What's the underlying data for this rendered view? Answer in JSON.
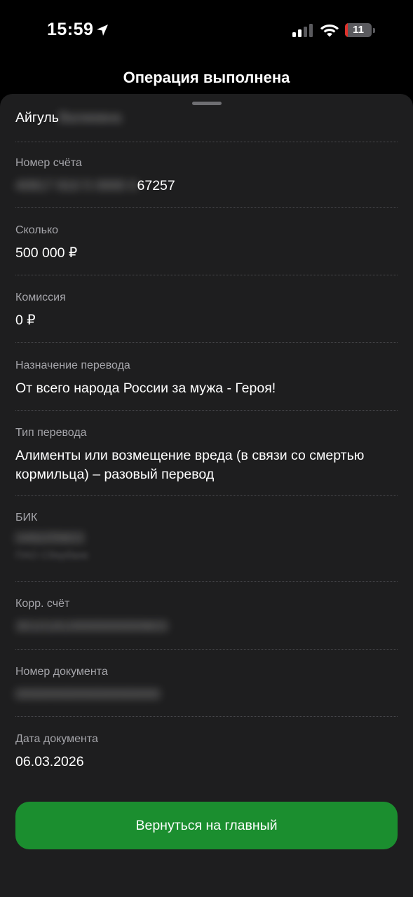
{
  "status_bar": {
    "time": "15:59",
    "battery_level": "11",
    "battery_fraction": 0.11,
    "location_icon": "location-arrow-icon",
    "signal_icon": "cellular-signal-icon",
    "wifi_icon": "wifi-icon",
    "battery_icon": "battery-icon"
  },
  "header": {
    "title": "Операция выполнена"
  },
  "recipient": {
    "name_visible": "Айгуль",
    "name_hidden": "Валиевна"
  },
  "details": {
    "account": {
      "label": "Номер счёта",
      "value_hidden": "40817 810 5 0000 0",
      "value_visible": "67257"
    },
    "amount": {
      "label": "Сколько",
      "value": "500 000 ₽"
    },
    "commission": {
      "label": "Комиссия",
      "value": "0 ₽"
    },
    "purpose": {
      "label": "Назначение перевода",
      "value": "От всего народа России за мужа - Героя!"
    },
    "transfer_type": {
      "label": "Тип перевода",
      "value": "Алименты или возмещение вреда (в связи со смертью кормильца) – разовый перевод"
    },
    "bik": {
      "label": "БИК",
      "value_hidden": "049205603",
      "bank_hidden": "ПАО Сбербанк"
    },
    "corr_account": {
      "label": "Корр. счёт",
      "value_hidden": "30101810000000000603"
    },
    "document_number": {
      "label": "Номер документа",
      "value_hidden": "0000000000000000000"
    },
    "document_date": {
      "label": "Дата документа",
      "value": "06.03.2026"
    }
  },
  "actions": {
    "home_label": "Вернуться на главный"
  },
  "colors": {
    "background": "#000000",
    "sheet": "#1e1e1f",
    "accent_green": "#1b8e2f",
    "label_gray": "#a5a5aa",
    "battery_red": "#e0312b"
  }
}
